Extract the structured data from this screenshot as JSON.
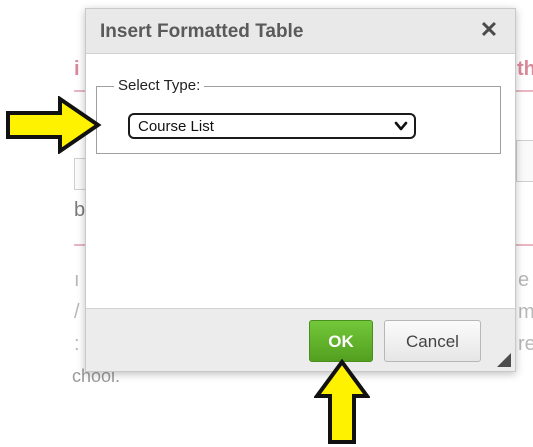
{
  "dialog": {
    "title": "Insert Formatted Table",
    "close_glyph": "✕"
  },
  "form": {
    "legend": "Select Type:",
    "select_value": "Course List"
  },
  "footer": {
    "ok_label": "OK",
    "cancel_label": "Cancel"
  },
  "background": {
    "school_text": "chool."
  },
  "colors": {
    "ok_green": "#5cb82c",
    "arrow_yellow": "#fff200",
    "title_bar": "#e9e9e9"
  },
  "icons": {
    "close": "close-icon",
    "dropdown": "chevron-down-icon",
    "resize": "resize-grip-icon",
    "arrow_right": "arrow-right-icon",
    "arrow_up": "arrow-up-icon"
  }
}
